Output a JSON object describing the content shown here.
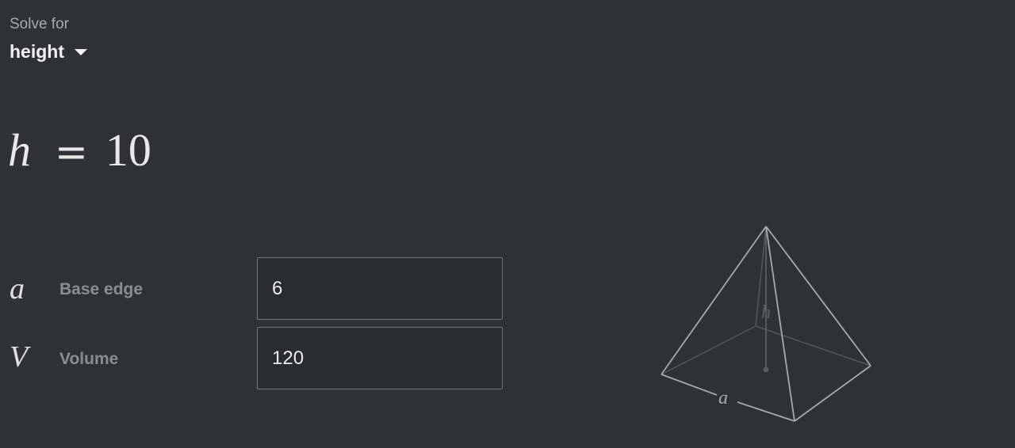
{
  "solve_for": {
    "label": "Solve for",
    "selected": "height"
  },
  "result": {
    "variable": "h",
    "equals": "=",
    "value": "10"
  },
  "inputs": [
    {
      "symbol": "a",
      "label": "Base edge",
      "value": "6"
    },
    {
      "symbol": "V",
      "label": "Volume",
      "value": "120"
    }
  ],
  "diagram": {
    "height_label": "h",
    "edge_label": "a",
    "colors": {
      "edges": "#a8a9ad",
      "hidden": "#55565a"
    }
  }
}
